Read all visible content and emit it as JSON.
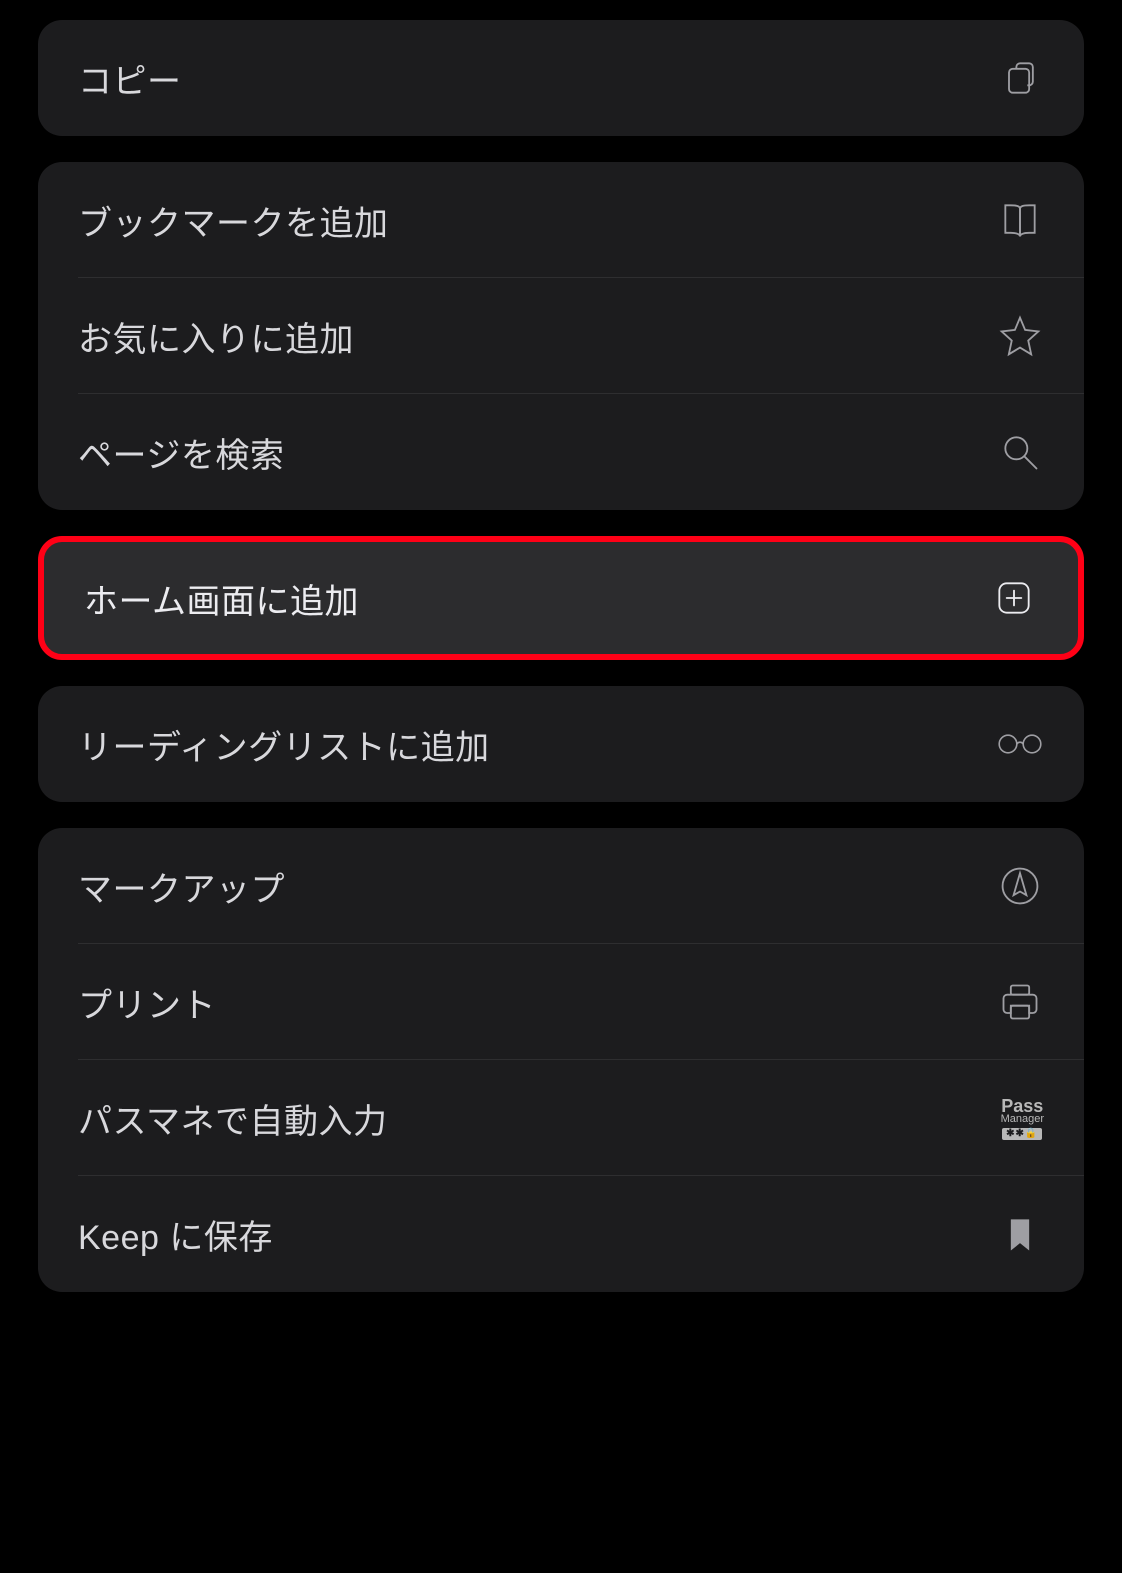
{
  "groups": [
    {
      "highlighted": false,
      "items": [
        {
          "label": "コピー",
          "icon": "copy-icon"
        }
      ]
    },
    {
      "highlighted": false,
      "items": [
        {
          "label": "ブックマークを追加",
          "icon": "book-icon"
        },
        {
          "label": "お気に入りに追加",
          "icon": "star-icon"
        },
        {
          "label": "ページを検索",
          "icon": "search-icon"
        }
      ]
    },
    {
      "highlighted": true,
      "items": [
        {
          "label": "ホーム画面に追加",
          "icon": "plus-square-icon"
        }
      ]
    },
    {
      "highlighted": false,
      "items": [
        {
          "label": "リーディングリストに追加",
          "icon": "glasses-icon"
        }
      ]
    },
    {
      "highlighted": false,
      "items": [
        {
          "label": "マークアップ",
          "icon": "markup-icon"
        },
        {
          "label": "プリント",
          "icon": "print-icon"
        },
        {
          "label": "パスマネで自動入力",
          "icon": "passmanager-icon",
          "pass_line1": "Pass",
          "pass_line2": "Manager",
          "pass_strip": "✱✱🔒"
        },
        {
          "label": "Keep に保存",
          "icon": "bookmark-fill-icon"
        }
      ]
    }
  ]
}
